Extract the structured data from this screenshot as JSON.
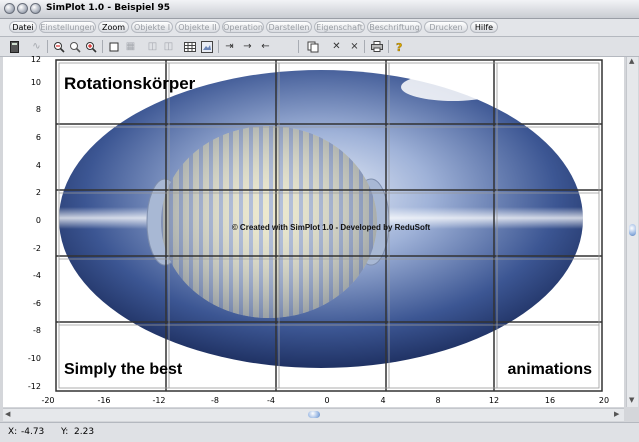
{
  "window": {
    "title": "SimPlot 1.0 - Beispiel 95"
  },
  "menu": [
    {
      "label": "Datei",
      "enabled": true
    },
    {
      "label": "Einstellungen",
      "enabled": false
    },
    {
      "label": "Zoom",
      "enabled": true
    },
    {
      "label": "Objekte I",
      "enabled": false
    },
    {
      "label": "Objekte II",
      "enabled": false
    },
    {
      "label": "Operation",
      "enabled": false
    },
    {
      "label": "Darstellen",
      "enabled": false
    },
    {
      "label": "Eigenschaft",
      "enabled": false
    },
    {
      "label": "Beschriftung",
      "enabled": false
    },
    {
      "label": "Drucken",
      "enabled": false
    },
    {
      "label": "Hilfe",
      "enabled": true
    }
  ],
  "toolbar": {
    "icons": [
      "calculator-icon",
      "curve-icon",
      "zoom-out-icon",
      "zoom-reset-icon",
      "zoom-in-icon",
      "square-icon",
      "grid-icon",
      "shape-select-icon",
      "shape-edit-icon",
      "table-icon",
      "image-icon",
      "export-icon",
      "arrow-right-icon",
      "arrow-left-icon",
      "copy-icon",
      "delete-x-icon",
      "delete-all-icon",
      "print-icon",
      "help-icon"
    ]
  },
  "plot": {
    "title_text": "Rotationskörper",
    "bottom_left_text": "Simply the best",
    "bottom_right_text": "animations",
    "watermark": "© Created with SimPlot 1.0 - Developed by ReduSoft",
    "y_ticks": [
      "12",
      "10",
      "8",
      "6",
      "4",
      "2",
      "0",
      "-2",
      "-4",
      "-6",
      "-8",
      "-10",
      "-12"
    ],
    "x_ticks": [
      "-20",
      "-16",
      "-12",
      "-8",
      "-4",
      "0",
      "4",
      "8",
      "12",
      "16",
      "20"
    ]
  },
  "status": {
    "x_label": "X:",
    "x_value": "-4.73",
    "y_label": "Y:",
    "y_value": "2.23"
  }
}
